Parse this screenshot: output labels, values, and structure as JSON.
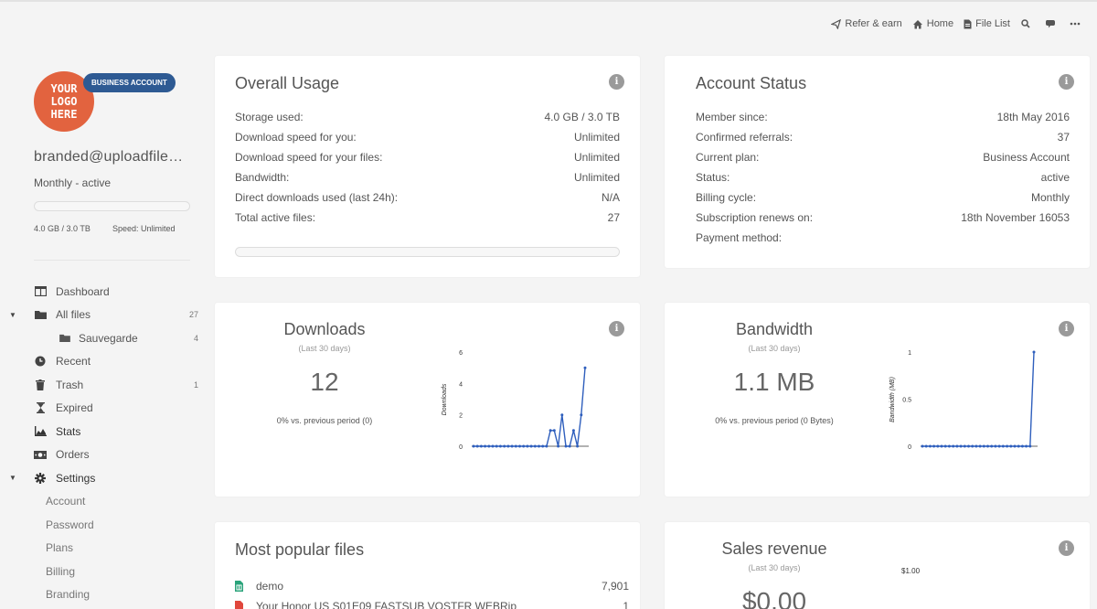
{
  "topnav": {
    "refer": "Refer & earn",
    "home": "Home",
    "file_list": "File List"
  },
  "sidebar": {
    "logo_lines": [
      "YOUR",
      "LOGO",
      "HERE"
    ],
    "badge": "BUSINESS ACCOUNT",
    "email": "branded@uploadfiles.io",
    "plan_status": "Monthly - active",
    "storage": "4.0 GB / 3.0 TB",
    "speed": "Speed: Unlimited",
    "nav": [
      {
        "label": "Dashboard",
        "icon": "dashboard-icon"
      },
      {
        "label": "All files",
        "count": "27",
        "icon": "folder-icon"
      },
      {
        "label": "Sauvegarde",
        "count": "4",
        "icon": "folder-icon"
      },
      {
        "label": "Recent",
        "icon": "clock-icon"
      },
      {
        "label": "Trash",
        "count": "1",
        "icon": "trash-icon"
      },
      {
        "label": "Expired",
        "icon": "hourglass-icon"
      },
      {
        "label": "Stats",
        "icon": "chart-icon"
      },
      {
        "label": "Orders",
        "icon": "money-icon"
      },
      {
        "label": "Settings",
        "icon": "gear-icon"
      },
      {
        "label": "Account"
      },
      {
        "label": "Password"
      },
      {
        "label": "Plans"
      },
      {
        "label": "Billing"
      },
      {
        "label": "Branding"
      }
    ]
  },
  "usage": {
    "title": "Overall Usage",
    "rows": [
      {
        "k": "Storage used:",
        "v": "4.0 GB / 3.0 TB"
      },
      {
        "k": "Download speed for you:",
        "v": "Unlimited"
      },
      {
        "k": "Download speed for your files:",
        "v": "Unlimited"
      },
      {
        "k": "Bandwidth:",
        "v": "Unlimited"
      },
      {
        "k": "Direct downloads used (last 24h):",
        "v": "N/A"
      },
      {
        "k": "Total active files:",
        "v": "27"
      }
    ]
  },
  "status": {
    "title": "Account Status",
    "rows": [
      {
        "k": "Member since:",
        "v": "18th May 2016"
      },
      {
        "k": "Confirmed referrals:",
        "v": "37"
      },
      {
        "k": "Current plan:",
        "v": "Business Account"
      },
      {
        "k": "Status:",
        "v": "active"
      },
      {
        "k": "Billing cycle:",
        "v": "Monthly"
      },
      {
        "k": "Subscription renews on:",
        "v": "18th November 16053"
      },
      {
        "k": "Payment method:",
        "v": ""
      }
    ]
  },
  "downloads": {
    "title": "Downloads",
    "sub": "(Last 30 days)",
    "big": "12",
    "delta": "0% vs. previous period (0)"
  },
  "bandwidth": {
    "title": "Bandwidth",
    "sub": "(Last 30 days)",
    "big": "1.1 MB",
    "delta": "0% vs. previous period (0 Bytes)"
  },
  "popular": {
    "title": "Most popular files",
    "files": [
      {
        "name": "demo",
        "count": "7,901",
        "icon": "spreadsheet-icon"
      },
      {
        "name": "Your Honor US S01E09 FASTSUB VOSTFR WEBRip",
        "count": "1",
        "icon": "pdf-icon"
      }
    ]
  },
  "sales": {
    "title": "Sales revenue",
    "sub": "(Last 30 days)",
    "big": "$0.00",
    "ytick": "$1.00"
  },
  "chart_data": [
    {
      "type": "line",
      "ylabel": "Downloads",
      "ylim": [
        0,
        6
      ],
      "yticks": [
        "0",
        "2",
        "4",
        "6"
      ],
      "x": [
        1,
        2,
        3,
        4,
        5,
        6,
        7,
        8,
        9,
        10,
        11,
        12,
        13,
        14,
        15,
        16,
        17,
        18,
        19,
        20,
        21,
        22,
        23,
        24,
        25,
        26,
        27,
        28,
        29,
        30
      ],
      "values": [
        0,
        0,
        0,
        0,
        0,
        0,
        0,
        0,
        0,
        0,
        0,
        0,
        0,
        0,
        0,
        0,
        0,
        0,
        0,
        0,
        1,
        1,
        0,
        2,
        0,
        0,
        1,
        0,
        2,
        5
      ],
      "color": "#2f5fbd"
    },
    {
      "type": "line",
      "ylabel": "Bandwidth (MB)",
      "ylim": [
        0,
        1
      ],
      "yticks": [
        "0",
        "0.5",
        "1"
      ],
      "x": [
        1,
        2,
        3,
        4,
        5,
        6,
        7,
        8,
        9,
        10,
        11,
        12,
        13,
        14,
        15,
        16,
        17,
        18,
        19,
        20,
        21,
        22,
        23,
        24,
        25,
        26,
        27,
        28,
        29,
        30
      ],
      "values": [
        0,
        0,
        0,
        0,
        0,
        0,
        0,
        0,
        0,
        0,
        0,
        0,
        0,
        0,
        0,
        0,
        0,
        0,
        0,
        0,
        0,
        0,
        0,
        0,
        0,
        0,
        0,
        0,
        0,
        1
      ],
      "color": "#2f5fbd"
    }
  ]
}
